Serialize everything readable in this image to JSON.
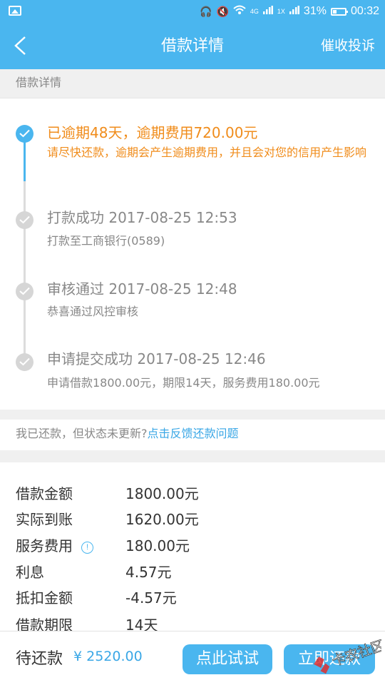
{
  "status_bar": {
    "network": "4G",
    "network2": "1X",
    "battery": "31%",
    "battery_level": 0.31,
    "time": "00:32"
  },
  "nav": {
    "title": "借款详情",
    "action": "催收投诉"
  },
  "section_header": "借款详情",
  "timeline": [
    {
      "title": "已逾期48天，逾期费用720.00元",
      "subtitle": "请尽快还款，逾期会产生逾期费用，并且会对您的信用产生影响",
      "active": true
    },
    {
      "title": "打款成功 2017-08-25 12:53",
      "subtitle": "打款至工商银行(0589)",
      "active": false
    },
    {
      "title": "审核通过 2017-08-25 12:48",
      "subtitle": "恭喜通过风控审核",
      "active": false
    },
    {
      "title": "申请提交成功 2017-08-25 12:46",
      "subtitle": "申请借款1800.00元，期限14天，服务费用180.00元",
      "active": false
    }
  ],
  "feedback": {
    "prompt": "我已还款，但状态未更新?",
    "link": "点击反馈还款问题"
  },
  "details": [
    {
      "label": "借款金额",
      "value": "1800.00元"
    },
    {
      "label": "实际到账",
      "value": "1620.00元"
    },
    {
      "label": "服务费用",
      "value": "180.00元",
      "info": true
    },
    {
      "label": "利息",
      "value": "4.57元"
    },
    {
      "label": "抵扣金额",
      "value": "-4.57元"
    },
    {
      "label": "借款期限",
      "value": "14天"
    }
  ],
  "bottom": {
    "due_label": "待还款",
    "due_amount": "¥ 2520.00",
    "try_button": "点此试试",
    "repay_button": "立即还款"
  },
  "watermark": "卡农社区",
  "colors": {
    "primary": "#4ab6ef",
    "warning": "#f08c1b",
    "link": "#3aa7e6"
  }
}
